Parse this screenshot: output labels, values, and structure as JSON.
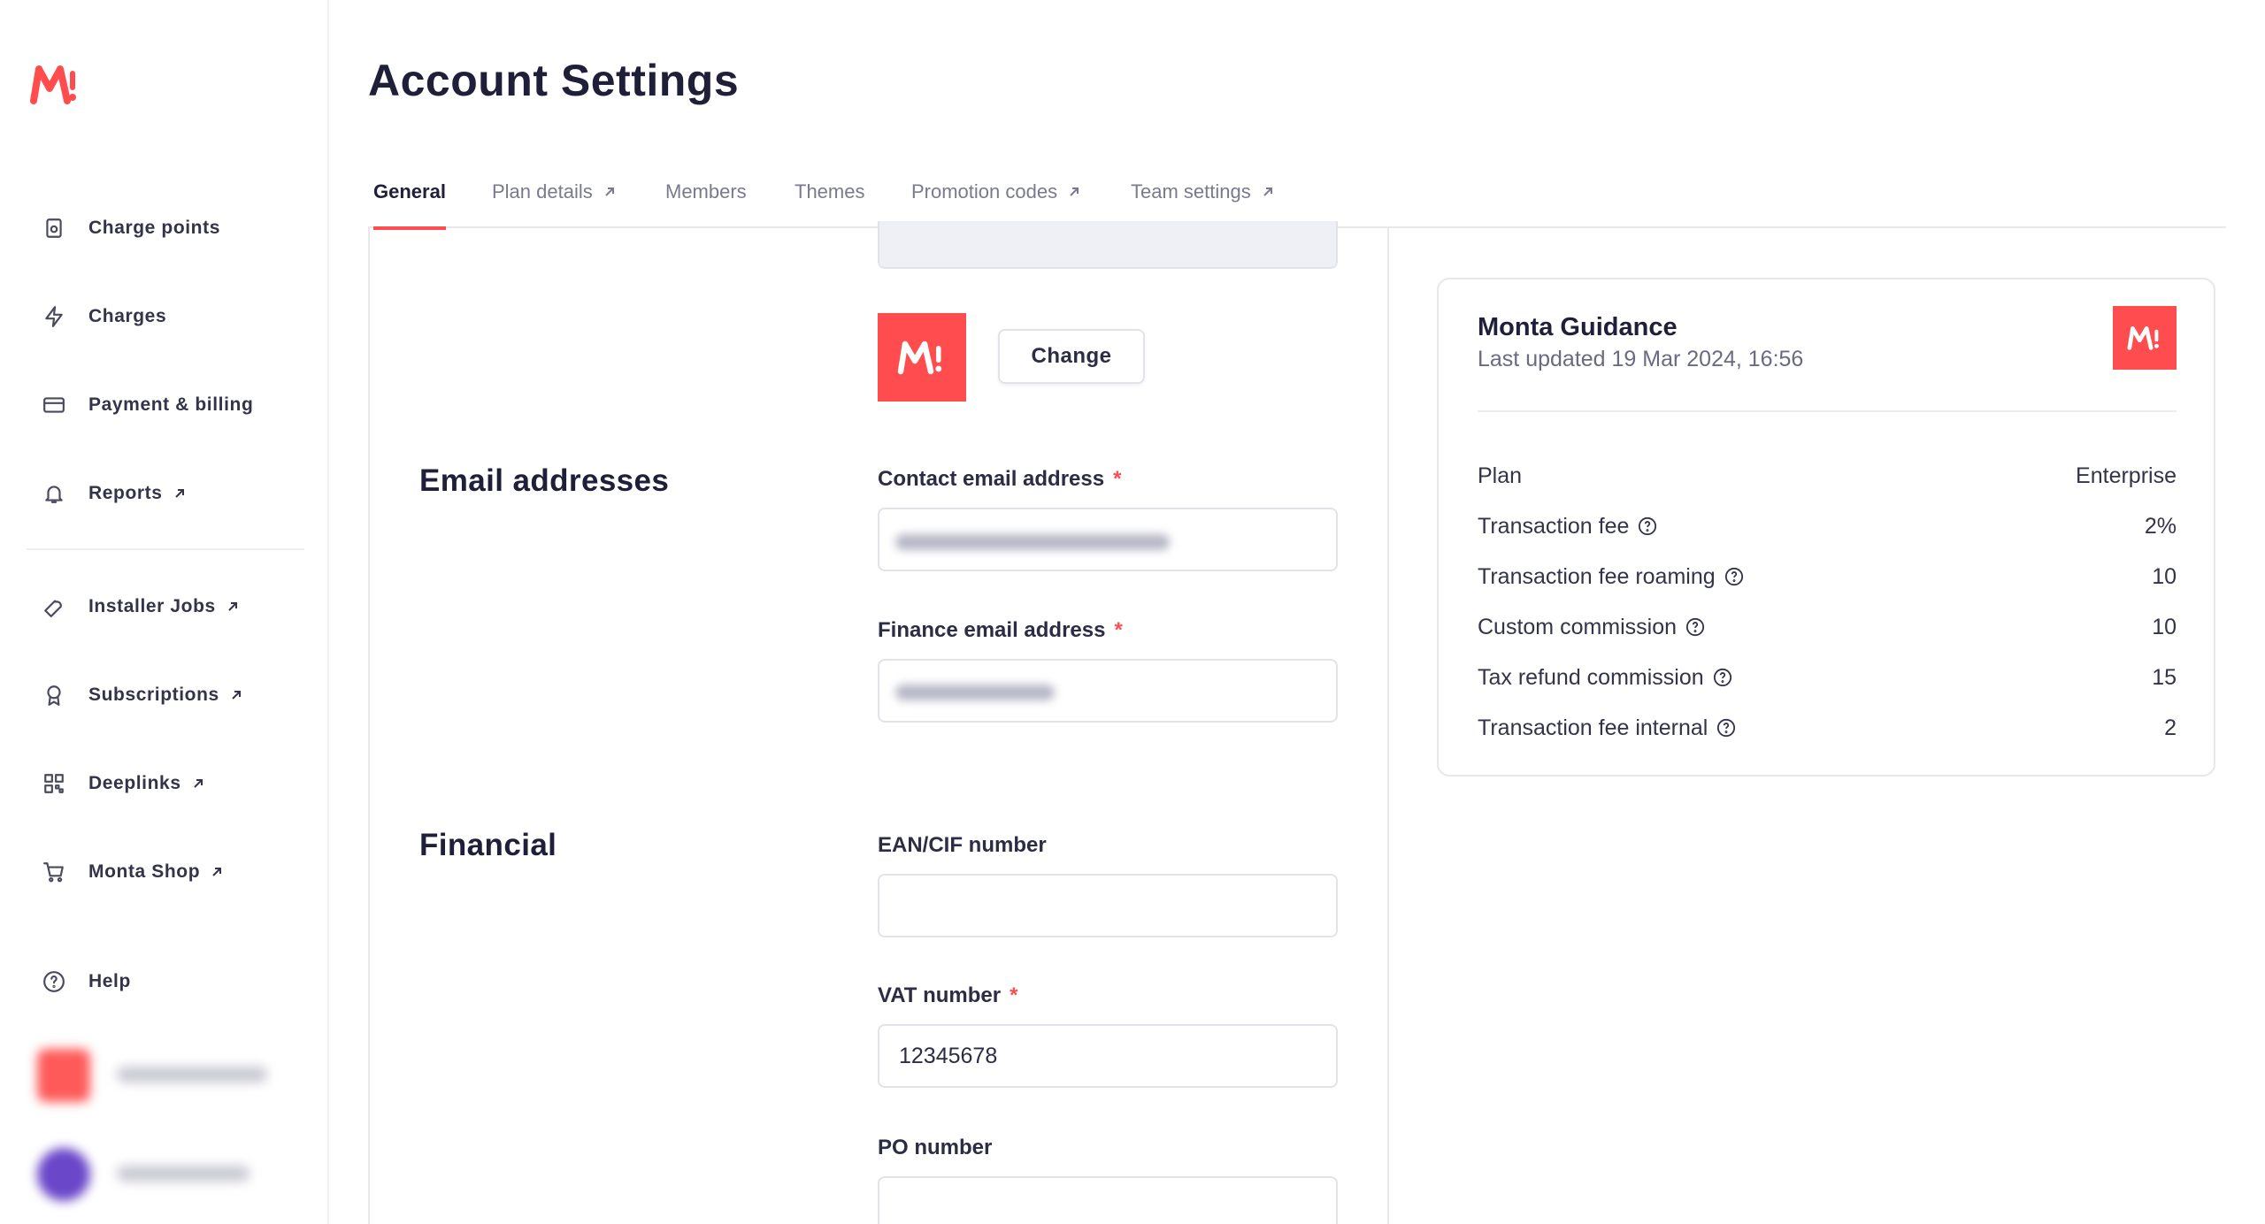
{
  "app": {
    "title": "Account Settings",
    "brand_color": "#ff4d4f"
  },
  "sidebar": {
    "items": [
      {
        "label": "Charge points",
        "icon": "charge-point-icon",
        "external": false
      },
      {
        "label": "Charges",
        "icon": "bolt-icon",
        "external": false
      },
      {
        "label": "Payment & billing",
        "icon": "credit-card-icon",
        "external": false
      },
      {
        "label": "Reports",
        "icon": "bell-icon",
        "external": true
      },
      {
        "label": "Installer Jobs",
        "icon": "wrench-icon",
        "external": true
      },
      {
        "label": "Subscriptions",
        "icon": "award-icon",
        "external": true
      },
      {
        "label": "Deeplinks",
        "icon": "qr-code-icon",
        "external": true
      },
      {
        "label": "Monta Shop",
        "icon": "cart-icon",
        "external": true
      },
      {
        "label": "Help",
        "icon": "help-circle-icon",
        "external": false
      }
    ]
  },
  "tabs": [
    {
      "label": "General",
      "active": true,
      "external": false
    },
    {
      "label": "Plan details",
      "active": false,
      "external": true
    },
    {
      "label": "Members",
      "active": false,
      "external": false
    },
    {
      "label": "Themes",
      "active": false,
      "external": false
    },
    {
      "label": "Promotion codes",
      "active": false,
      "external": true
    },
    {
      "label": "Team settings",
      "active": false,
      "external": true
    }
  ],
  "logo_section": {
    "change_label": "Change"
  },
  "email": {
    "title": "Email addresses",
    "contact_label": "Contact email address",
    "finance_label": "Finance email address",
    "required_mark": "*"
  },
  "financial": {
    "title": "Financial",
    "ean_label": "EAN/CIF number",
    "ean_value": "",
    "vat_label": "VAT number",
    "vat_value": "12345678",
    "po_label": "PO number",
    "po_value": "",
    "required_mark": "*"
  },
  "guidance": {
    "title": "Monta Guidance",
    "updated": "Last updated 19 Mar 2024, 16:56",
    "rows": [
      {
        "label": "Plan",
        "value": "Enterprise",
        "help": false
      },
      {
        "label": "Transaction fee",
        "value": "2%",
        "help": true
      },
      {
        "label": "Transaction fee roaming",
        "value": "10",
        "help": true
      },
      {
        "label": "Custom commission",
        "value": "10",
        "help": true
      },
      {
        "label": "Tax refund commission",
        "value": "15",
        "help": true
      },
      {
        "label": "Transaction fee internal",
        "value": "2",
        "help": true
      }
    ]
  }
}
